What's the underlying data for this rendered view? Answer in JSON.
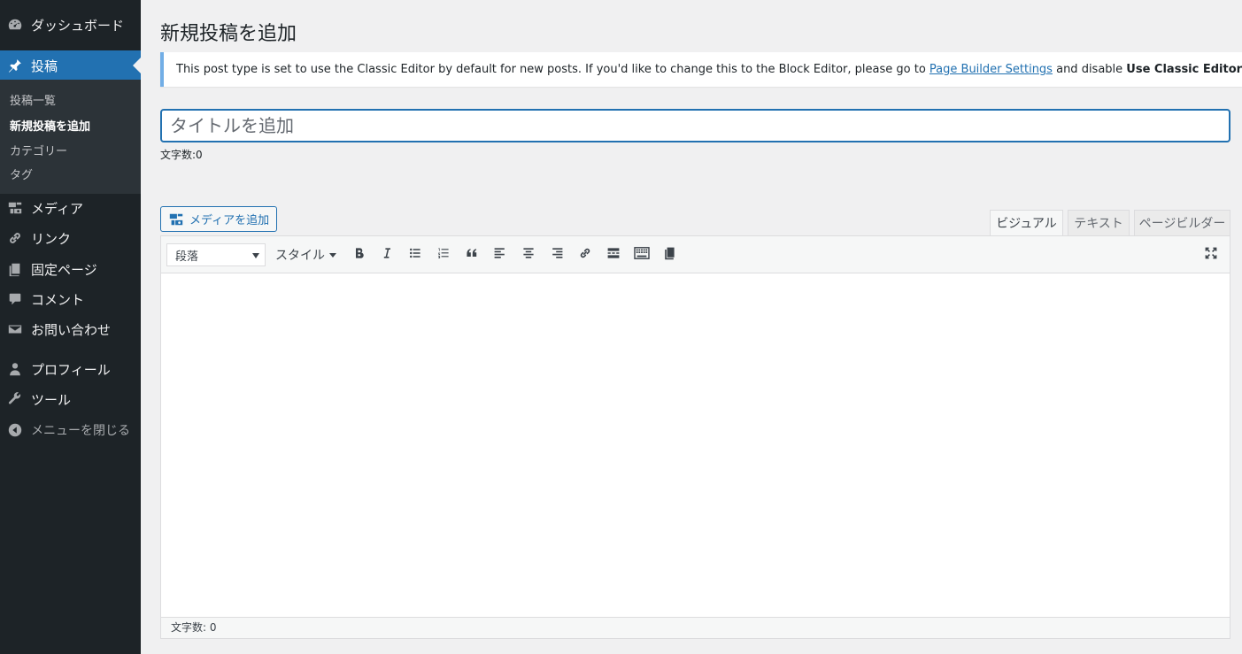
{
  "sidebar": {
    "dashboard": "ダッシュボード",
    "posts": "投稿",
    "submenu": [
      "投稿一覧",
      "新規投稿を追加",
      "カテゴリー",
      "タグ"
    ],
    "media": "メディア",
    "links": "リンク",
    "pages": "固定ページ",
    "comments": "コメント",
    "contact": "お問い合わせ",
    "profile": "プロフィール",
    "tools": "ツール",
    "collapse": "メニューを閉じる"
  },
  "main": {
    "title": "新規投稿を追加",
    "notice": {
      "text_before": "This post type is set to use the Classic Editor by default for new posts. If you'd like to change this to the Block Editor, please go to ",
      "link": "Page Builder Settings",
      "text_middle": " and disable ",
      "bold": "Use Classic Editor for New Posts",
      "text_end": "."
    },
    "title_placeholder": "タイトルを追加",
    "title_value": "",
    "char_count": "文字数:0",
    "add_media": "メディアを追加",
    "tabs": [
      "ビジュアル",
      "テキスト",
      "ページビルダー"
    ],
    "format_select": "段落",
    "style_label": "スタイル",
    "status_word_count": "文字数: 0"
  },
  "colors": {
    "sidebar_bg": "#1d2327",
    "active_menu": "#2271b1",
    "notice_border": "#72aee6",
    "link": "#2271b1"
  }
}
